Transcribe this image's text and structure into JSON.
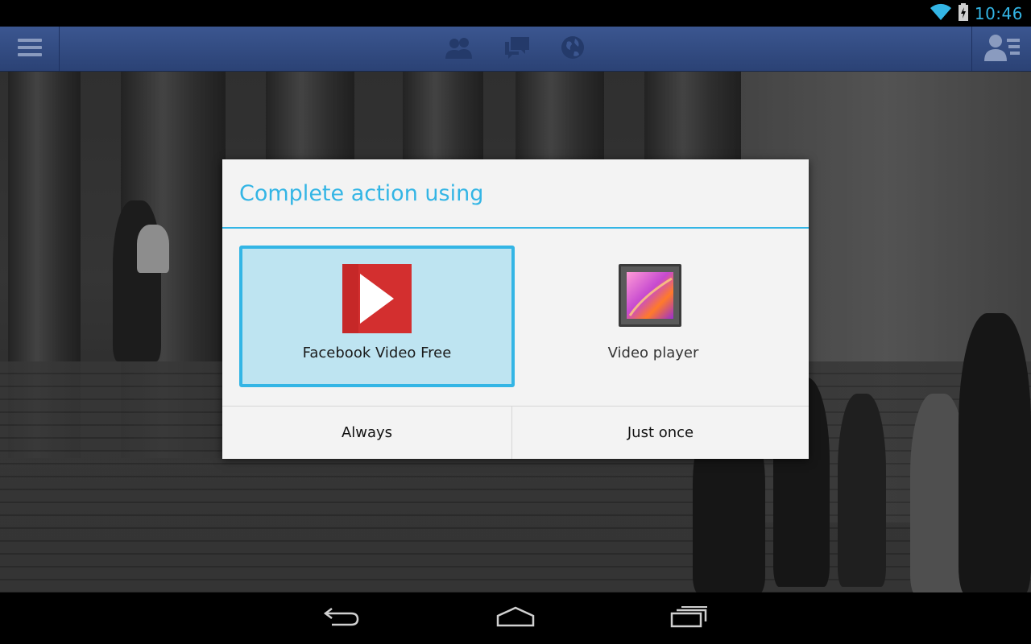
{
  "status_bar": {
    "time": "10:46",
    "icons": [
      "wifi-icon",
      "battery-charging-icon"
    ],
    "accent_color": "#33b5e5"
  },
  "action_bar": {
    "left_icon": "menu-icon",
    "center_icons": [
      "friend-requests-icon",
      "messages-icon",
      "notifications-globe-icon"
    ],
    "right_icon": "friends-list-icon",
    "background_color": "#3b5690"
  },
  "dialog": {
    "title": "Complete action using",
    "apps": [
      {
        "label": "Facebook Video Free",
        "icon": "play-video-icon",
        "selected": true
      },
      {
        "label": "Video player",
        "icon": "video-player-gallery-icon",
        "selected": false
      }
    ],
    "buttons": {
      "always": "Always",
      "just_once": "Just once"
    },
    "accent_color": "#33b5e5"
  },
  "nav_bar": {
    "icons": [
      "back-icon",
      "home-icon",
      "recent-apps-icon"
    ]
  }
}
